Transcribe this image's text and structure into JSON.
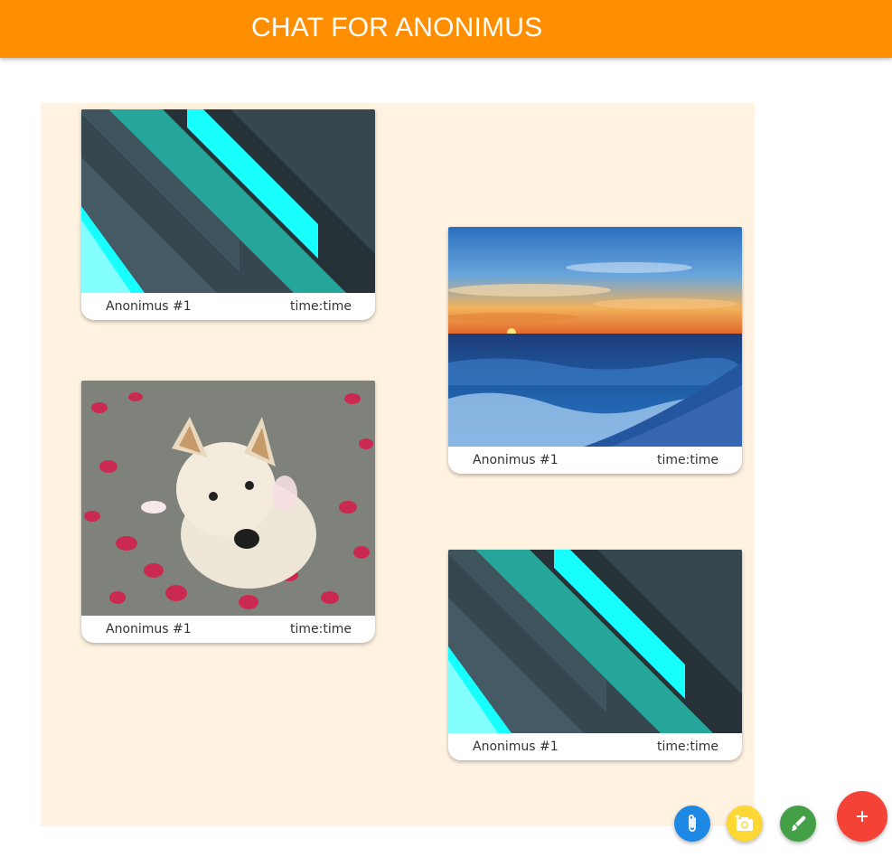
{
  "header": {
    "title": "CHAT FOR ANONIMUS",
    "bg_color": "#ff8f00"
  },
  "chat": {
    "bg_color": "#fff2e1",
    "messages": [
      {
        "author": "Anonimus #1",
        "time": "time:time",
        "image": "material-design-wallpaper"
      },
      {
        "author": "Anonimus #1",
        "time": "time:time",
        "image": "sunset-beach-photo"
      },
      {
        "author": "Anonimus #1",
        "time": "time:time",
        "image": "puppy-with-petals-photo"
      },
      {
        "author": "Anonimus #1",
        "time": "time:time",
        "image": "material-design-wallpaper"
      }
    ]
  },
  "fab_menu": {
    "buttons": [
      {
        "icon": "paperclip-icon",
        "color": "#1e88e5"
      },
      {
        "icon": "add-photo-icon",
        "color": "#fdd835"
      },
      {
        "icon": "brush-icon",
        "color": "#43a047"
      },
      {
        "icon": "plus-icon",
        "color": "#f44336"
      }
    ]
  }
}
